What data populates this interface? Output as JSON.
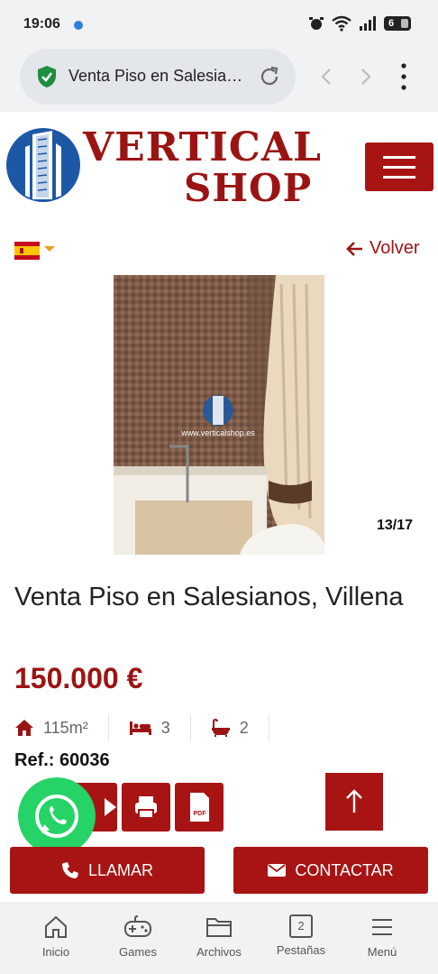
{
  "status_bar": {
    "time": "19:06",
    "battery": "6"
  },
  "browser": {
    "tab_title": "Venta Piso en Salesia…"
  },
  "site": {
    "logo_line1": "VERTICAL",
    "logo_line2": "SHOP",
    "back_label": "Volver",
    "language_flag": "es-flag-icon"
  },
  "gallery": {
    "counter": "13/17",
    "watermark": "www.verticalshop.es"
  },
  "listing": {
    "title": "Venta Piso en Salesianos, Villena",
    "price": "150.000 €",
    "area": "115m²",
    "bedrooms": "3",
    "bathrooms": "2",
    "ref": "Ref.: 60036"
  },
  "actions": {
    "call_label": "LLAMAR",
    "contact_label": "CONTACTAR"
  },
  "bottom_nav": {
    "items": [
      {
        "label": "Inicio",
        "icon": "home-icon"
      },
      {
        "label": "Games",
        "icon": "gamepad-icon"
      },
      {
        "label": "Archivos",
        "icon": "folder-icon"
      },
      {
        "label": "Pestañas",
        "icon": "tabs-icon",
        "count": "2"
      },
      {
        "label": "Menú",
        "icon": "menu-icon"
      }
    ]
  },
  "colors": {
    "brand": "#a81414",
    "whatsapp": "#25d366",
    "logo_blue": "#1d58a6"
  }
}
